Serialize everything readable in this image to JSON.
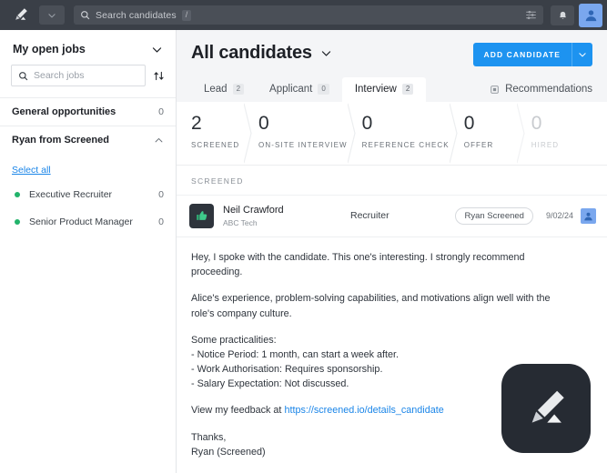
{
  "topbar": {
    "logo_icon": "pencil-logo-icon",
    "workspace_caret_icon": "chevron-down-icon",
    "search": {
      "icon": "search-icon",
      "placeholder": "Search candidates",
      "value": "",
      "shortcut_key": "/",
      "filter_icon": "filter-sliders-icon"
    },
    "notifications_icon": "bell-icon",
    "account_icon": "user-avatar-icon"
  },
  "sidebar": {
    "heading": "My open jobs",
    "collapse_icon": "chevron-down-icon",
    "search": {
      "icon": "search-icon",
      "placeholder": "Search jobs",
      "value": ""
    },
    "sort_icon": "sort-arrows-icon",
    "sections": [
      {
        "label": "General opportunities",
        "count": "0",
        "icon": ""
      },
      {
        "label": "Ryan from Screened",
        "count": "",
        "icon": "chevron-up-icon"
      }
    ],
    "select_all": "Select all",
    "jobs": [
      {
        "status": "open",
        "name": "Executive Recruiter",
        "count": "0"
      },
      {
        "status": "open",
        "name": "Senior Product Manager",
        "count": "0"
      }
    ]
  },
  "main": {
    "title": "All candidates",
    "title_caret_icon": "chevron-down-icon",
    "add_candidate_label": "ADD CANDIDATE",
    "add_candidate_caret_icon": "chevron-down-icon",
    "tabs": [
      {
        "label": "Lead",
        "badge": "2",
        "active": false
      },
      {
        "label": "Applicant",
        "badge": "0",
        "active": false
      },
      {
        "label": "Interview",
        "badge": "2",
        "active": true
      }
    ],
    "recommendations": {
      "label": "Recommendations",
      "icon": "grid-square-icon"
    },
    "stats": [
      {
        "value": "2",
        "label": "SCREENED",
        "muted": false
      },
      {
        "value": "0",
        "label": "ON-SITE INTERVIEW",
        "muted": false
      },
      {
        "value": "0",
        "label": "REFERENCE CHECK",
        "muted": false
      },
      {
        "value": "0",
        "label": "OFFER",
        "muted": false
      },
      {
        "value": "0",
        "label": "HIRED",
        "muted": true
      }
    ],
    "section_label": "SCREENED",
    "candidate": {
      "avatar_icon": "thumbs-up-icon",
      "name": "Neil Crawford",
      "company": "ABC Tech",
      "role": "Recruiter",
      "source_pill": "Ryan Screened",
      "date": "9/02/24",
      "owner_icon": "user-avatar-icon"
    },
    "message": {
      "para1": "Hey, I spoke with the candidate. This one's interesting. I strongly recommend proceeding.",
      "para2": "Alice's experience, problem-solving capabilities, and motivations align well with the role's company culture.",
      "list_heading": "Some practicalities:",
      "list_item1": "- Notice Period: 1 month, can start a week after.",
      "list_item2": "- Work Authorisation: Requires sponsorship.",
      "list_item3": "- Salary Expectation: Not discussed.",
      "feedback_prefix": "View my feedback at ",
      "feedback_link": "https://screened.io/details_candidate",
      "signoff1": "Thanks,",
      "signoff2": "Ryan (Screened)"
    }
  },
  "fab": {
    "icon": "pencil-brand-icon"
  },
  "colors": {
    "topbar_bg": "#3a3f47",
    "accent_blue": "#1d93f0",
    "link_blue": "#1a85e8",
    "status_green": "#22b36b",
    "avatar_blue": "#7aa7ee",
    "dark_panel": "#262b33",
    "page_bg": "#f4f5f7"
  }
}
